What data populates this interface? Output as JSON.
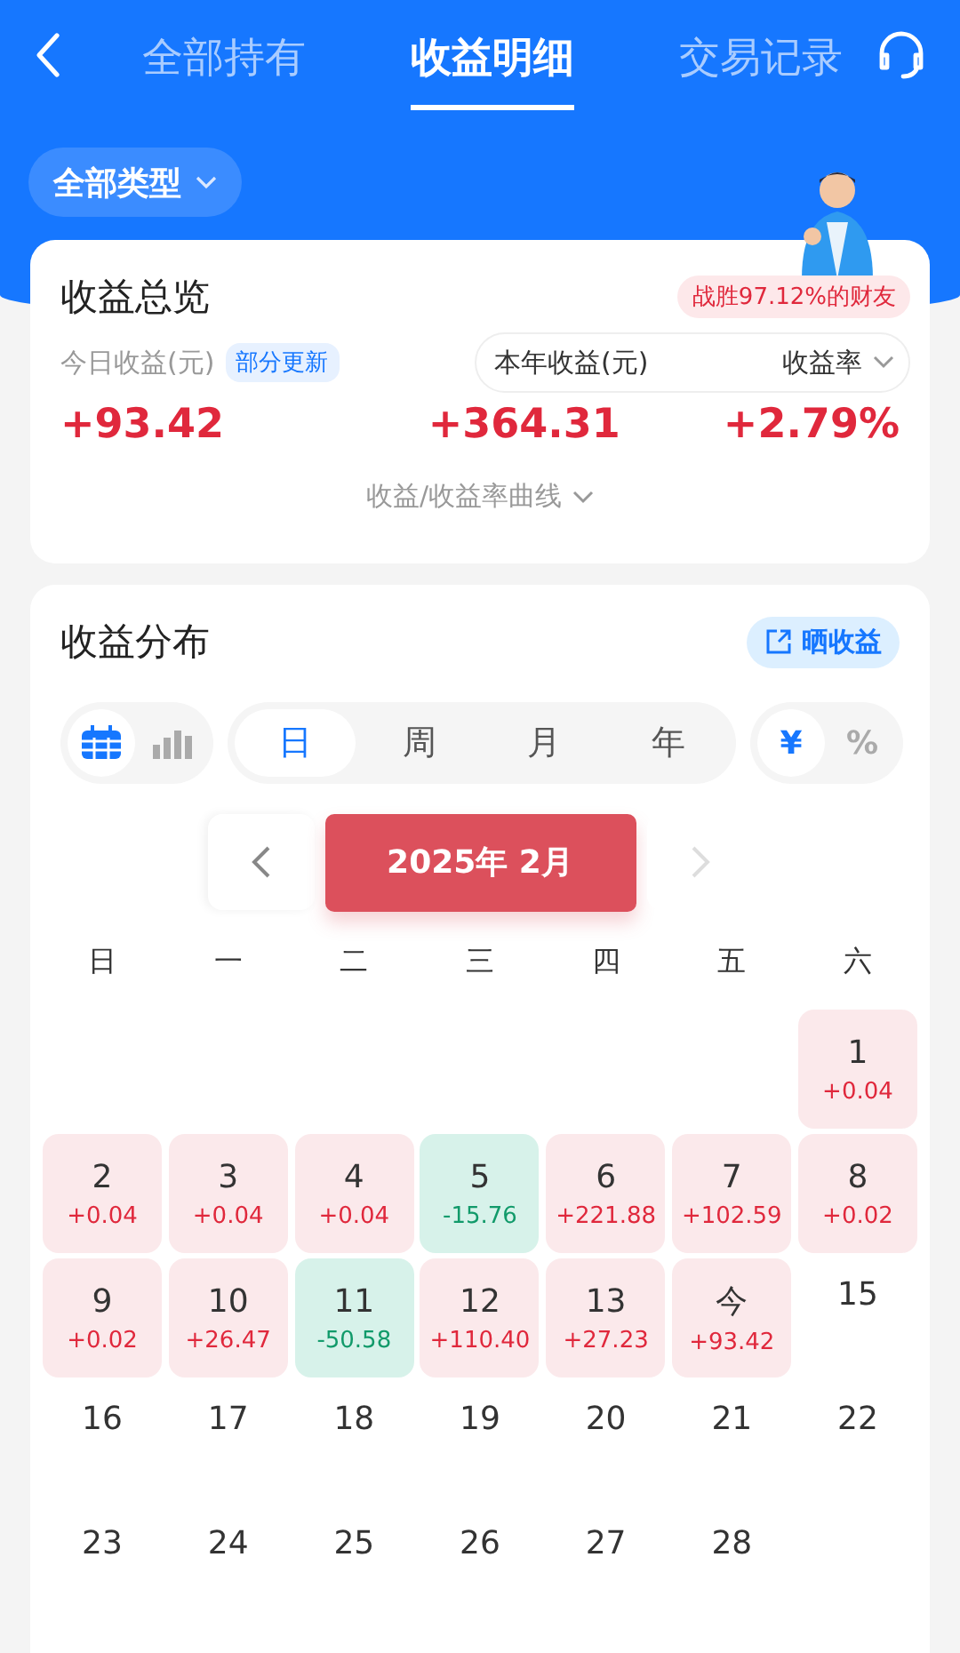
{
  "nav": {
    "tabs": [
      {
        "label": "全部持有",
        "selected": false
      },
      {
        "label": "收益明细",
        "selected": true
      },
      {
        "label": "交易记录",
        "selected": false
      }
    ]
  },
  "filter": {
    "label": "全部类型"
  },
  "overview": {
    "title": "收益总览",
    "rank_badge": "战胜97.12%的财友",
    "today_label": "今日收益(元)",
    "today_tag": "部分更新",
    "today_value": "+93.42",
    "year_label": "本年收益(元)",
    "rate_label": "收益率",
    "year_value": "+364.31",
    "rate_value": "+2.79%",
    "curve_link": "收益/收益率曲线"
  },
  "distribution": {
    "title": "收益分布",
    "share_button": "晒收益",
    "views": [
      {
        "kind": "calendar",
        "selected": true
      },
      {
        "kind": "bars",
        "selected": false
      }
    ],
    "periods": [
      {
        "label": "日",
        "selected": true
      },
      {
        "label": "周",
        "selected": false
      },
      {
        "label": "月",
        "selected": false
      },
      {
        "label": "年",
        "selected": false
      }
    ],
    "units": [
      {
        "label": "¥",
        "selected": true
      },
      {
        "label": "%",
        "selected": false
      }
    ],
    "month": "2025年 2月",
    "weekdays": [
      "日",
      "一",
      "二",
      "三",
      "四",
      "五",
      "六"
    ],
    "weeks": [
      [
        {
          "kind": "empty"
        },
        {
          "kind": "empty"
        },
        {
          "kind": "empty"
        },
        {
          "kind": "empty"
        },
        {
          "kind": "empty"
        },
        {
          "kind": "empty"
        },
        {
          "kind": "gain",
          "day": "1",
          "value": "+0.04"
        }
      ],
      [
        {
          "kind": "gain",
          "day": "2",
          "value": "+0.04"
        },
        {
          "kind": "gain",
          "day": "3",
          "value": "+0.04"
        },
        {
          "kind": "gain",
          "day": "4",
          "value": "+0.04"
        },
        {
          "kind": "loss",
          "day": "5",
          "value": "-15.76"
        },
        {
          "kind": "gain",
          "day": "6",
          "value": "+221.88"
        },
        {
          "kind": "gain",
          "day": "7",
          "value": "+102.59"
        },
        {
          "kind": "gain",
          "day": "8",
          "value": "+0.02"
        }
      ],
      [
        {
          "kind": "gain",
          "day": "9",
          "value": "+0.02"
        },
        {
          "kind": "gain",
          "day": "10",
          "value": "+26.47"
        },
        {
          "kind": "loss",
          "day": "11",
          "value": "-50.58"
        },
        {
          "kind": "gain",
          "day": "12",
          "value": "+110.40"
        },
        {
          "kind": "gain",
          "day": "13",
          "value": "+27.23"
        },
        {
          "kind": "gain",
          "day": "今",
          "value": "+93.42"
        },
        {
          "kind": "plain",
          "day": "15"
        }
      ],
      [
        {
          "kind": "plain",
          "day": "16"
        },
        {
          "kind": "plain",
          "day": "17"
        },
        {
          "kind": "plain",
          "day": "18"
        },
        {
          "kind": "plain",
          "day": "19"
        },
        {
          "kind": "plain",
          "day": "20"
        },
        {
          "kind": "plain",
          "day": "21"
        },
        {
          "kind": "plain",
          "day": "22"
        }
      ],
      [
        {
          "kind": "plain",
          "day": "23"
        },
        {
          "kind": "plain",
          "day": "24"
        },
        {
          "kind": "plain",
          "day": "25"
        },
        {
          "kind": "plain",
          "day": "26"
        },
        {
          "kind": "plain",
          "day": "27"
        },
        {
          "kind": "plain",
          "day": "28"
        },
        {
          "kind": "empty"
        }
      ]
    ]
  }
}
